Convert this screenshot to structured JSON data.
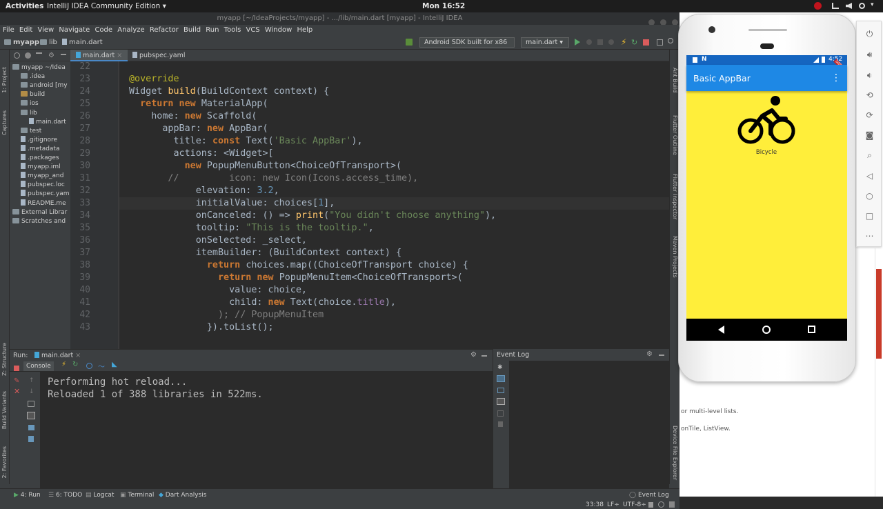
{
  "topbar": {
    "activities": "Activities",
    "app_menu": "IntelliJ IDEA Community Edition ▾",
    "clock": "Mon 16:52"
  },
  "window_title": "myapp [~/IdeaProjects/myapp] - .../lib/main.dart [myapp] - IntelliJ IDEA",
  "menu": [
    "File",
    "Edit",
    "View",
    "Navigate",
    "Code",
    "Analyze",
    "Refactor",
    "Build",
    "Run",
    "Tools",
    "VCS",
    "Window",
    "Help"
  ],
  "breadcrumb": {
    "project": "myapp",
    "folder": "lib",
    "file": "main.dart"
  },
  "toolbar": {
    "device": "Android SDK built for x86",
    "run_config": "main.dart"
  },
  "editor_tabs": [
    "main.dart",
    "pubspec.yaml"
  ],
  "project_tree": [
    {
      "label": "myapp ~/Idea",
      "indent": 0,
      "kind": "folder"
    },
    {
      "label": ".idea",
      "indent": 1,
      "kind": "folder"
    },
    {
      "label": "android [my",
      "indent": 1,
      "kind": "folder"
    },
    {
      "label": "build",
      "indent": 1,
      "kind": "folder-orange"
    },
    {
      "label": "ios",
      "indent": 1,
      "kind": "folder"
    },
    {
      "label": "lib",
      "indent": 1,
      "kind": "folder"
    },
    {
      "label": "main.dart",
      "indent": 2,
      "kind": "file"
    },
    {
      "label": "test",
      "indent": 1,
      "kind": "folder"
    },
    {
      "label": ".gitignore",
      "indent": 1,
      "kind": "file"
    },
    {
      "label": ".metadata",
      "indent": 1,
      "kind": "file"
    },
    {
      "label": ".packages",
      "indent": 1,
      "kind": "file"
    },
    {
      "label": "myapp.iml",
      "indent": 1,
      "kind": "file"
    },
    {
      "label": "myapp_and",
      "indent": 1,
      "kind": "file"
    },
    {
      "label": "pubspec.loc",
      "indent": 1,
      "kind": "file"
    },
    {
      "label": "pubspec.yam",
      "indent": 1,
      "kind": "file"
    },
    {
      "label": "README.me",
      "indent": 1,
      "kind": "file"
    },
    {
      "label": "External Librar",
      "indent": 0,
      "kind": "folder"
    },
    {
      "label": "Scratches and",
      "indent": 0,
      "kind": "folder"
    }
  ],
  "line_numbers": [
    "22",
    "23",
    "24",
    "25",
    "26",
    "27",
    "28",
    "29",
    "30",
    "31",
    "32",
    "33",
    "34",
    "35",
    "36",
    "37",
    "38",
    "39",
    "40",
    "41",
    "42",
    "43"
  ],
  "code_lines": [
    [],
    [
      {
        "t": "@override",
        "c": "an"
      }
    ],
    [
      {
        "t": "Widget ",
        "c": ""
      },
      {
        "t": "build",
        "c": "fn"
      },
      {
        "t": "(BuildContext context) {",
        "c": ""
      }
    ],
    [
      {
        "t": "  ",
        "c": ""
      },
      {
        "t": "return new ",
        "c": "kw"
      },
      {
        "t": "MaterialApp(",
        "c": ""
      }
    ],
    [
      {
        "t": "    home: ",
        "c": ""
      },
      {
        "t": "new ",
        "c": "kw"
      },
      {
        "t": "Scaffold(",
        "c": ""
      }
    ],
    [
      {
        "t": "      appBar: ",
        "c": ""
      },
      {
        "t": "new ",
        "c": "kw"
      },
      {
        "t": "AppBar(",
        "c": ""
      }
    ],
    [
      {
        "t": "        title: ",
        "c": ""
      },
      {
        "t": "const ",
        "c": "kw"
      },
      {
        "t": "Text(",
        "c": ""
      },
      {
        "t": "'Basic AppBar'",
        "c": "st"
      },
      {
        "t": "),",
        "c": ""
      }
    ],
    [
      {
        "t": "        actions: <Widget>[",
        "c": ""
      }
    ],
    [
      {
        "t": "          ",
        "c": ""
      },
      {
        "t": "new ",
        "c": "kw"
      },
      {
        "t": "PopupMenuButton<ChoiceOfTransport>(",
        "c": ""
      }
    ],
    [
      {
        "t": "       //         icon: new Icon(Icons.access_time),",
        "c": "cm"
      }
    ],
    [
      {
        "t": "            elevation: ",
        "c": ""
      },
      {
        "t": "3.2",
        "c": "nu"
      },
      {
        "t": ",",
        "c": ""
      }
    ],
    [
      {
        "t": "            initialValue: choices[",
        "c": ""
      },
      {
        "t": "1",
        "c": "nu"
      },
      {
        "t": "],",
        "c": ""
      }
    ],
    [
      {
        "t": "            onCanceled: () => ",
        "c": ""
      },
      {
        "t": "print",
        "c": "fn"
      },
      {
        "t": "(",
        "c": ""
      },
      {
        "t": "\"You didn't choose anything\"",
        "c": "st"
      },
      {
        "t": "),",
        "c": ""
      }
    ],
    [
      {
        "t": "            tooltip: ",
        "c": ""
      },
      {
        "t": "\"This is the tooltip.\"",
        "c": "st"
      },
      {
        "t": ",",
        "c": ""
      }
    ],
    [
      {
        "t": "            onSelected: _select,",
        "c": ""
      }
    ],
    [
      {
        "t": "            itemBuilder: (BuildContext context) {",
        "c": ""
      }
    ],
    [
      {
        "t": "              ",
        "c": ""
      },
      {
        "t": "return ",
        "c": "kw"
      },
      {
        "t": "choices.map((ChoiceOfTransport choice) {",
        "c": ""
      }
    ],
    [
      {
        "t": "                ",
        "c": ""
      },
      {
        "t": "return new ",
        "c": "kw"
      },
      {
        "t": "PopupMenuItem<ChoiceOfTransport>(",
        "c": ""
      }
    ],
    [
      {
        "t": "                  value: choice,",
        "c": ""
      }
    ],
    [
      {
        "t": "                  child: ",
        "c": ""
      },
      {
        "t": "new ",
        "c": "kw"
      },
      {
        "t": "Text(choice.",
        "c": ""
      },
      {
        "t": "title",
        "c": "pr"
      },
      {
        "t": "),",
        "c": ""
      }
    ],
    [
      {
        "t": "                ); // PopupMenuItem",
        "c": "cm"
      }
    ],
    [
      {
        "t": "              }).toList();",
        "c": ""
      }
    ]
  ],
  "run_panel": {
    "label": "Run:",
    "config": "main.dart",
    "console_tab": "Console"
  },
  "console_lines": [
    "Performing hot reload...",
    "Reloaded 1 of 388 libraries in 522ms."
  ],
  "event_log": {
    "title": "Event Log"
  },
  "left_tool_windows": [
    "1: Project",
    "Captures",
    "Z: Structure",
    "Build Variants",
    "2: Favorites"
  ],
  "right_tool_windows": [
    "Ant Build",
    "Flutter Outline",
    "Flutter Inspector",
    "Maven Projects",
    "Device File Explorer"
  ],
  "statusbar": {
    "tabs": [
      "4: Run",
      "6: TODO",
      "Logcat",
      "Terminal",
      "Dart Analysis"
    ],
    "event_log": "Event Log",
    "position": "33:38",
    "line_sep": "LF÷",
    "encoding": "UTF-8÷"
  },
  "emulator": {
    "time": "4:52",
    "debug_badge": "DEBUG",
    "appbar_title": "Basic AppBar",
    "more_icon": "⋮",
    "choice_label": "Bicycle",
    "screen_color": "#ffee3a",
    "appbar_color": "#1e88e5"
  },
  "background_page": {
    "line1": "or multi-level lists.",
    "line2": "onTile, ListView."
  }
}
